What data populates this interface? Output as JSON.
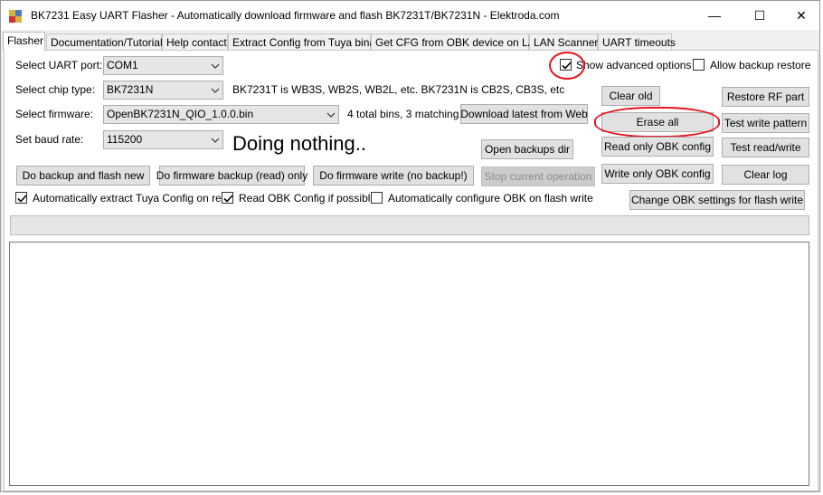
{
  "window": {
    "title": "BK7231 Easy UART Flasher - Automatically download firmware and flash BK7231T/BK7231N  - Elektroda.com",
    "minimize_glyph": "—",
    "maximize_glyph": "☐",
    "close_glyph": "✕"
  },
  "tabs": [
    "Flasher",
    "Documentation/Tutorials",
    "Help contact",
    "Extract Config from Tuya binary",
    "Get CFG from OBK device on LAN",
    "LAN Scanner",
    "UART timeouts"
  ],
  "form": {
    "uart_label": "Select UART port:",
    "uart_value": "COM1",
    "chip_label": "Select chip type:",
    "chip_value": "BK7231N",
    "chip_info": "BK7231T is WB3S, WB2S, WB2L, etc. BK7231N is CB2S, CB3S, etc",
    "firmware_label": "Select firmware:",
    "firmware_value": "OpenBK7231N_QIO_1.0.0.bin",
    "bins_info": "4 total bins, 3 matching.",
    "baud_label": "Set baud rate:",
    "baud_value": "115200",
    "status": "Doing nothing.."
  },
  "buttons": {
    "download_latest": "Download latest from Web",
    "open_backups": "Open backups dir",
    "backup_and_flash": "Do backup and flash new",
    "firmware_backup": "Do firmware backup (read) only",
    "firmware_write": "Do firmware write (no backup!)",
    "stop_operation": "Stop current operation",
    "clear_old": "Clear old",
    "erase_all": "Erase all",
    "read_only_obk": "Read only OBK config",
    "write_only_obk": "Write only OBK config",
    "restore_rf": "Restore RF part",
    "test_write": "Test write pattern",
    "test_read_write": "Test read/write",
    "clear_log": "Clear log",
    "change_obk": "Change OBK settings for flash write"
  },
  "checkboxes": {
    "show_advanced": {
      "label": "Show advanced options",
      "checked": true
    },
    "allow_backup_restore": {
      "label": "Allow backup restore",
      "checked": false
    },
    "auto_extract_tuya": {
      "label": "Automatically extract Tuya Config on read",
      "checked": true
    },
    "read_obk_config": {
      "label": "Read OBK Config if possible",
      "checked": true
    },
    "auto_configure_obk": {
      "label": "Automatically configure OBK on flash write",
      "checked": false
    }
  },
  "progress": {
    "value": 0
  },
  "colors": {
    "annotation": "#e8121c",
    "window_bg": "#f0f0f0",
    "button_bg": "#e1e1e1"
  }
}
